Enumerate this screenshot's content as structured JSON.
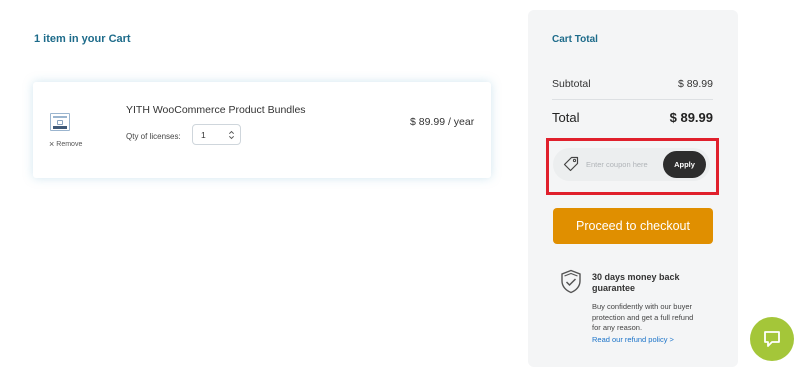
{
  "cart": {
    "heading": "1 item in your Cart",
    "item": {
      "name": "YITH WooCommerce Product Bundles",
      "remove_label": "Remove",
      "qty_label": "Qty of licenses:",
      "qty_value": "1",
      "price": "$ 89.99 / year"
    }
  },
  "totals": {
    "title": "Cart Total",
    "subtotal_label": "Subtotal",
    "subtotal_value": "$ 89.99",
    "total_label": "Total",
    "total_value": "$ 89.99",
    "coupon_placeholder": "Enter coupon here",
    "apply_label": "Apply",
    "checkout_label": "Proceed to checkout",
    "guarantee_title": "30 days money back guarantee",
    "guarantee_body": "Buy confidently with our buyer protection and get a full refund for any reason.",
    "refund_link": "Read our refund policy >"
  },
  "icons": {
    "remove": "close-icon",
    "qty": "chevron-up-down-icon",
    "coupon": "tag-icon",
    "guarantee": "shield-check-icon",
    "chat": "chat-icon"
  },
  "colors": {
    "accent_teal": "#1d6b8a",
    "checkout_orange": "#e08f00",
    "apply_dark": "#2d2d2d",
    "highlight_red": "#e0202c",
    "chat_green": "#a4c639",
    "link_blue": "#1a73c9"
  }
}
